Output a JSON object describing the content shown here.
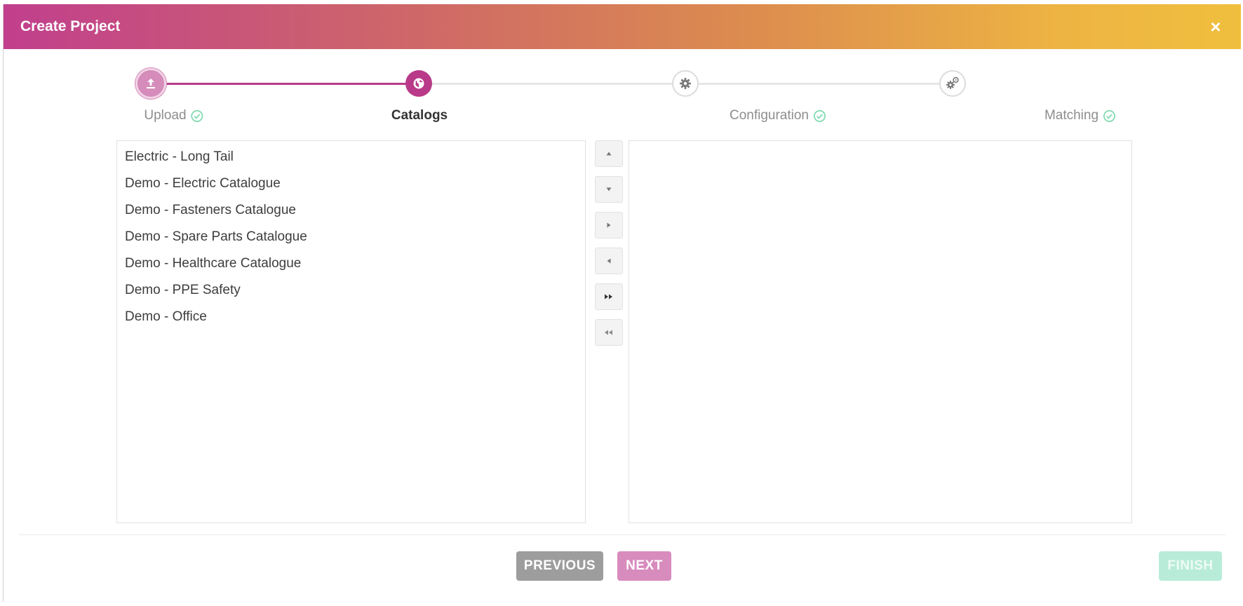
{
  "dialog": {
    "title": "Create Project",
    "close_label": "×"
  },
  "stepper": {
    "steps": [
      {
        "label": "Upload",
        "state": "done",
        "icon": "upload-icon"
      },
      {
        "label": "Catalogs",
        "state": "current",
        "icon": "globe-icon"
      },
      {
        "label": "Configuration",
        "state": "pending",
        "icon": "gear-icon"
      },
      {
        "label": "Matching",
        "state": "pending",
        "icon": "gears-icon"
      }
    ]
  },
  "available_list": {
    "items": [
      "Electric - Long Tail",
      "Demo - Electric Catalogue",
      "Demo - Fasteners Catalogue",
      "Demo - Spare Parts Catalogue",
      "Demo - Healthcare Catalogue",
      "Demo - PPE Safety",
      "Demo - Office"
    ]
  },
  "selected_list": {
    "items": []
  },
  "move_buttons": [
    {
      "name": "move-up-button",
      "icon": "triangle-up-icon"
    },
    {
      "name": "move-down-button",
      "icon": "triangle-down-icon"
    },
    {
      "name": "move-right-button",
      "icon": "triangle-right-icon"
    },
    {
      "name": "move-left-button",
      "icon": "triangle-left-icon"
    },
    {
      "name": "move-all-right-button",
      "icon": "double-right-icon"
    },
    {
      "name": "move-all-left-button",
      "icon": "double-left-icon"
    }
  ],
  "footer": {
    "previous_label": "PREVIOUS",
    "next_label": "NEXT",
    "finish_label": "FINISH"
  },
  "colors": {
    "accent": "#b83a88",
    "done_step": "#d58cba",
    "check": "#7fd9b0",
    "finish_disabled": "#b8ecd8"
  }
}
